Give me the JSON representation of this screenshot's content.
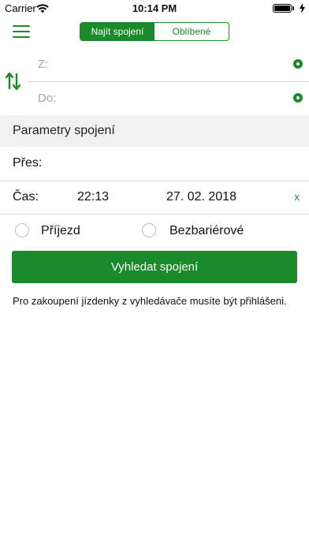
{
  "status_bar": {
    "carrier": "Carrier",
    "time": "10:14 PM",
    "battery_level": 1.0
  },
  "nav": {
    "menu_icon": "hamburger-menu-icon",
    "tabs": [
      {
        "label": "Najít spojení",
        "active": true
      },
      {
        "label": "Oblíbené",
        "active": false
      }
    ]
  },
  "route": {
    "swap_icon": "swap-arrows-icon",
    "from_label": "Z:",
    "to_label": "Do:",
    "locate_icon": "location-dot-icon"
  },
  "parameters": {
    "title": "Parametry spojení",
    "via_label": "Přes:",
    "time_label": "Čas:",
    "time_value": "22:13",
    "date_value": "27. 02. 2018",
    "clear_label": "x",
    "arrival_label": "Příjezd",
    "barrier_free_label": "Bezbariérové"
  },
  "search_button": "Vyhledat spojení",
  "notice": "Pro zakoupení jízdenky z vyhledávače musíte být přihlášeni.",
  "colors": {
    "accent": "#1a8a2a",
    "section_bg": "#f1f1f1",
    "placeholder": "#a5a5a5"
  }
}
